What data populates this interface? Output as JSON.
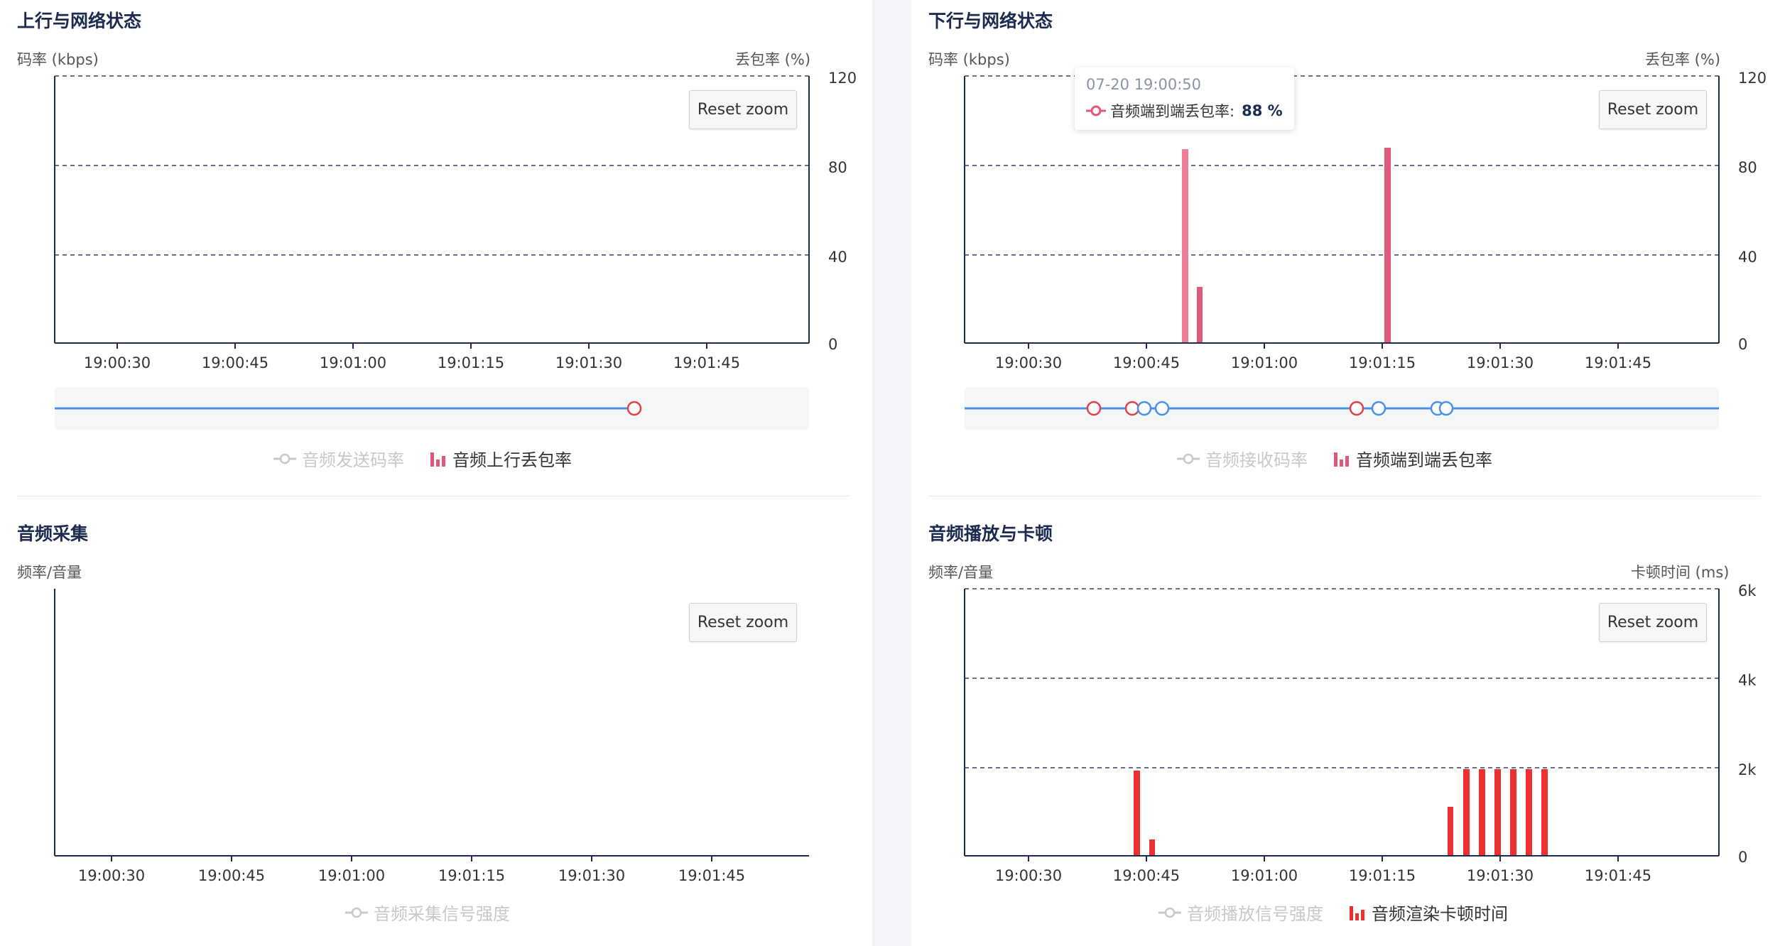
{
  "colors": {
    "axis": "#1b2a4e",
    "grid": "#3a3f6b",
    "loss_bar": "#e0587a",
    "stall_bar": "#ee3030",
    "line_blue": "#4a90e8",
    "marker_red": "#e34040",
    "legend_off": "#c8c8c8"
  },
  "time_ticks": [
    "19:00:30",
    "19:00:45",
    "19:01:00",
    "19:01:15",
    "19:01:30",
    "19:01:45"
  ],
  "reset_zoom_label": "Reset zoom",
  "panels": {
    "uplink": {
      "title": "上行与网络状态",
      "left_axis_title": "码率 (kbps)",
      "right_axis_title": "丢包率 (%)",
      "right_ticks": [
        "120",
        "80",
        "40",
        "0"
      ],
      "legend": [
        {
          "label": "音频发送码率",
          "icon": "line-marker-icon",
          "state": "off"
        },
        {
          "label": "音频上行丢包率",
          "icon": "bar-chart-icon",
          "state": "on"
        }
      ]
    },
    "downlink": {
      "title": "下行与网络状态",
      "left_axis_title": "码率 (kbps)",
      "right_axis_title": "丢包率 (%)",
      "right_ticks": [
        "120",
        "80",
        "40",
        "0"
      ],
      "tooltip": {
        "time": "07-20 19:00:50",
        "series": "音频端到端丢包率:",
        "value": "88 %"
      },
      "legend": [
        {
          "label": "音频接收码率",
          "icon": "line-marker-icon",
          "state": "off"
        },
        {
          "label": "音频端到端丢包率",
          "icon": "bar-chart-icon",
          "state": "on"
        }
      ]
    },
    "capture": {
      "title": "音频采集",
      "left_axis_title": "频率/音量",
      "legend": [
        {
          "label": "音频采集信号强度",
          "icon": "line-marker-icon",
          "state": "off"
        }
      ]
    },
    "playback": {
      "title": "音频播放与卡顿",
      "left_axis_title": "频率/音量",
      "right_axis_title": "卡顿时间 (ms)",
      "right_ticks": [
        "6k",
        "4k",
        "2k",
        "0"
      ],
      "legend": [
        {
          "label": "音频播放信号强度",
          "icon": "line-marker-icon",
          "state": "off"
        },
        {
          "label": "音频渲染卡顿时间",
          "icon": "bar-chart-icon",
          "state": "on"
        }
      ]
    }
  },
  "chart_data": [
    {
      "name": "上行与网络状态",
      "type": "bar",
      "xlabel": "",
      "ylabel": "码率 (kbps)",
      "y2label": "丢包率 (%)",
      "y2lim": [
        0,
        120
      ],
      "x_ticks": [
        "19:00:30",
        "19:00:45",
        "19:01:00",
        "19:01:15",
        "19:01:30",
        "19:01:45"
      ],
      "series": [
        {
          "name": "音频发送码率",
          "type": "line",
          "visible": false,
          "points": []
        },
        {
          "name": "音频上行丢包率",
          "type": "bar",
          "visible": true,
          "points": []
        }
      ],
      "grid": true
    },
    {
      "name": "下行与网络状态",
      "type": "bar",
      "xlabel": "",
      "ylabel": "码率 (kbps)",
      "y2label": "丢包率 (%)",
      "y2lim": [
        0,
        120
      ],
      "x_ticks": [
        "19:00:30",
        "19:00:45",
        "19:01:00",
        "19:01:15",
        "19:01:30",
        "19:01:45"
      ],
      "series": [
        {
          "name": "音频接收码率",
          "type": "line",
          "visible": false,
          "points": []
        },
        {
          "name": "音频端到端丢包率",
          "type": "bar",
          "visible": true,
          "points": [
            {
              "x": "19:00:50",
              "y": 88
            },
            {
              "x": "19:00:52",
              "y": 25
            },
            {
              "x": "19:01:16",
              "y": 88
            }
          ]
        }
      ],
      "grid": true
    },
    {
      "name": "音频采集",
      "type": "line",
      "xlabel": "",
      "ylabel": "频率/音量",
      "x_ticks": [
        "19:00:30",
        "19:00:45",
        "19:01:00",
        "19:01:15",
        "19:01:30",
        "19:01:45"
      ],
      "series": [
        {
          "name": "音频采集信号强度",
          "type": "line",
          "visible": false,
          "points": []
        }
      ],
      "grid": false
    },
    {
      "name": "音频播放与卡顿",
      "type": "bar",
      "xlabel": "",
      "ylabel": "频率/音量",
      "y2label": "卡顿时间 (ms)",
      "y2lim": [
        0,
        6000
      ],
      "x_ticks": [
        "19:00:30",
        "19:00:45",
        "19:01:00",
        "19:01:15",
        "19:01:30",
        "19:01:45"
      ],
      "series": [
        {
          "name": "音频播放信号强度",
          "type": "line",
          "visible": false,
          "points": []
        },
        {
          "name": "音频渲染卡顿时间",
          "type": "bar",
          "visible": true,
          "points": [
            {
              "x": "19:00:44",
              "y": 1900
            },
            {
              "x": "19:00:46",
              "y": 350
            },
            {
              "x": "19:01:24",
              "y": 1100
            },
            {
              "x": "19:01:26",
              "y": 1950
            },
            {
              "x": "19:01:28",
              "y": 1950
            },
            {
              "x": "19:01:30",
              "y": 1950
            },
            {
              "x": "19:01:32",
              "y": 1950
            },
            {
              "x": "19:01:34",
              "y": 1950
            },
            {
              "x": "19:01:36",
              "y": 1950
            }
          ]
        }
      ],
      "grid": true
    }
  ]
}
